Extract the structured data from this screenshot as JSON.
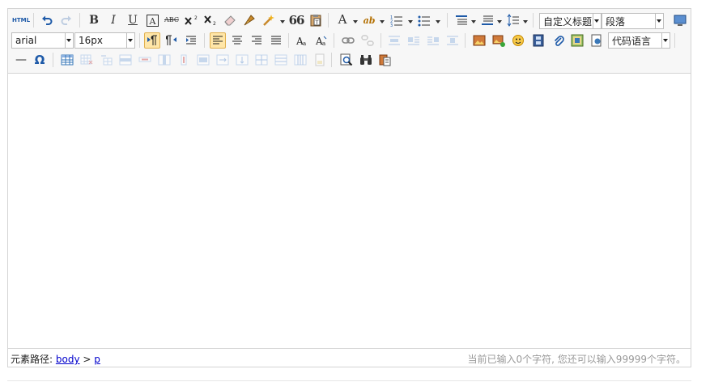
{
  "toolbar": {
    "source_label": "HTML",
    "bold_label": "B",
    "italic_label": "I",
    "underline_label": "U",
    "strike_label": "ABC",
    "blockquote_label": "66",
    "fontcolor_label": "A",
    "backcolor_label": "ab",
    "customstyle": "自定义标题",
    "paragraph": "段落",
    "fontfamily": "arial",
    "fontsize": "16px",
    "insertcode": "代码语言",
    "horizontal_label": "—",
    "special_chars_label": "Ω"
  },
  "colors": {
    "accent": "#1e5aa8",
    "active_bg": "#ffe6a8",
    "toolbar_bg": "#f7f7f7",
    "border": "#d4d4d4",
    "link": "#0000cc"
  },
  "statusbar": {
    "path_label": "元素路径:",
    "path_body": "body",
    "path_sep": ">",
    "path_p": "p",
    "wordcount": "当前已输入0个字符, 您还可以输入99999个字符。"
  }
}
